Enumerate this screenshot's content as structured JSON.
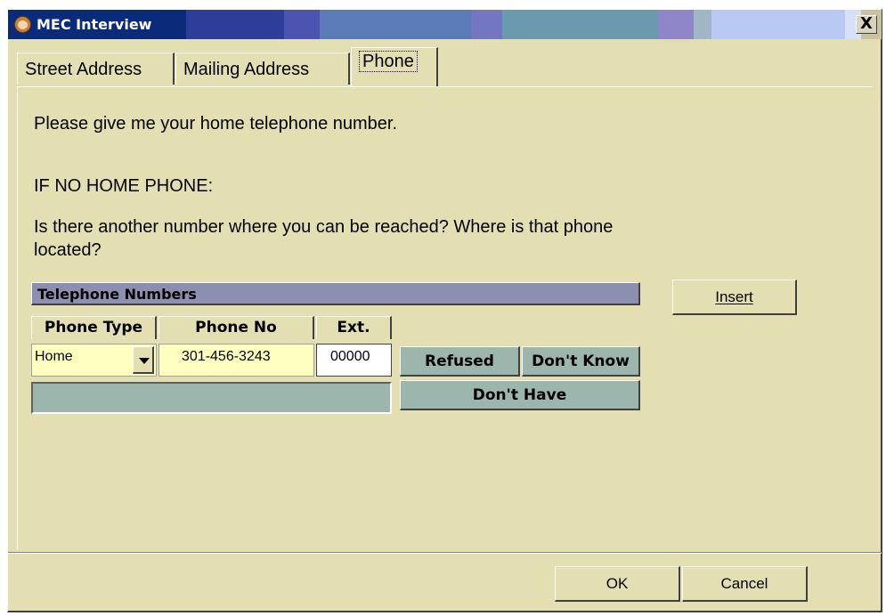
{
  "window": {
    "title": "MEC Interview",
    "close_label": "X"
  },
  "tabs": [
    {
      "label": "Street Address",
      "active": false
    },
    {
      "label": "Mailing Address",
      "active": false
    },
    {
      "label": "Phone",
      "active": true
    }
  ],
  "prompt": {
    "line1": "Please give me your home telephone number.",
    "line2": "IF NO HOME PHONE:",
    "line3a": "Is there another number where you can be reached?  Where is that phone",
    "line3b": "located?"
  },
  "telephone": {
    "header": "Telephone Numbers",
    "insert_label": "Insert",
    "columns": {
      "type": "Phone Type",
      "number": "Phone No",
      "ext": "Ext."
    },
    "row": {
      "type": "Home",
      "number": "301-456-3243",
      "ext": "00000"
    },
    "refused_label": "Refused",
    "dont_know_label": "Don't Know",
    "dont_have_label": "Don't Have"
  },
  "footer": {
    "ok_label": "OK",
    "cancel_label": "Cancel"
  },
  "colors": {
    "window_bg": "#e3dfb3",
    "grid_header": "#8d8fb0",
    "teal": "#9cb6ae",
    "input_yellow": "#ffffc0"
  }
}
